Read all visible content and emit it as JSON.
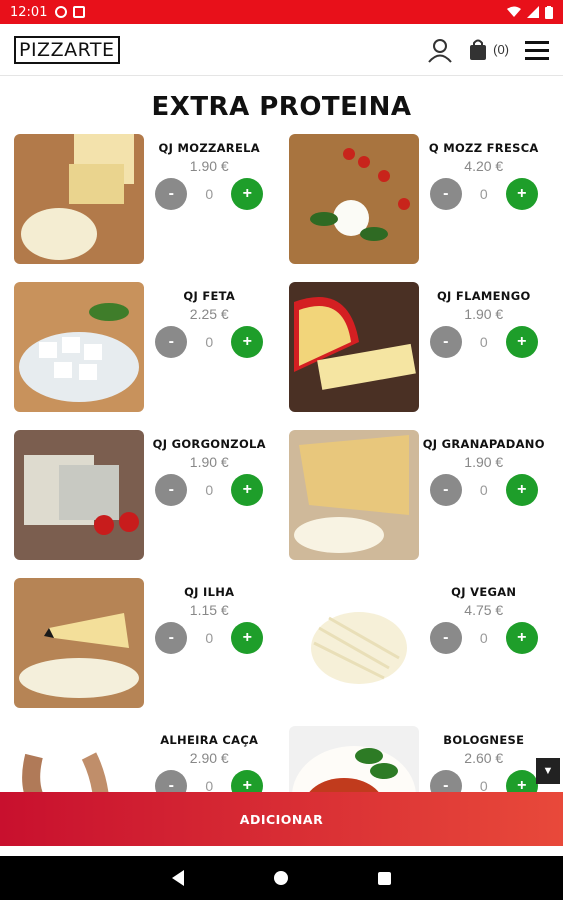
{
  "status": {
    "time": "12:01"
  },
  "header": {
    "logo": "PIZZARTE",
    "cart_count": "(0)"
  },
  "title": "EXTRA PROTEINA",
  "products": [
    {
      "name": "QJ MOZZARELA",
      "price": "1.90 €",
      "qty": "0",
      "image": "mozzarella"
    },
    {
      "name": "Q MOZZ FRESCA",
      "price": "4.20 €",
      "qty": "0",
      "image": "fresh-mozzarella"
    },
    {
      "name": "QJ FETA",
      "price": "2.25 €",
      "qty": "0",
      "image": "feta"
    },
    {
      "name": "QJ FLAMENGO",
      "price": "1.90 €",
      "qty": "0",
      "image": "flamengo"
    },
    {
      "name": "QJ GORGONZOLA",
      "price": "1.90 €",
      "qty": "0",
      "image": "gorgonzola"
    },
    {
      "name": "QJ GRANAPADANO",
      "price": "1.90 €",
      "qty": "0",
      "image": "grana-padano"
    },
    {
      "name": "QJ ILHA",
      "price": "1.15 €",
      "qty": "0",
      "image": "ilha"
    },
    {
      "name": "QJ VEGAN",
      "price": "4.75 €",
      "qty": "0",
      "image": "vegan"
    },
    {
      "name": "ALHEIRA CAÇA",
      "price": "2.90 €",
      "qty": "0",
      "image": "alheira"
    },
    {
      "name": "BOLOGNESE",
      "price": "2.60 €",
      "qty": "0",
      "image": "bolognese"
    }
  ],
  "buttons": {
    "minus": "-",
    "plus": "+",
    "add": "ADICIONAR"
  },
  "colors": {
    "status_bar": "#e8101a",
    "plus": "#1e9e2a",
    "minus": "#8a8a8a",
    "add_bar_start": "#c8102e",
    "add_bar_end": "#e8493a"
  }
}
